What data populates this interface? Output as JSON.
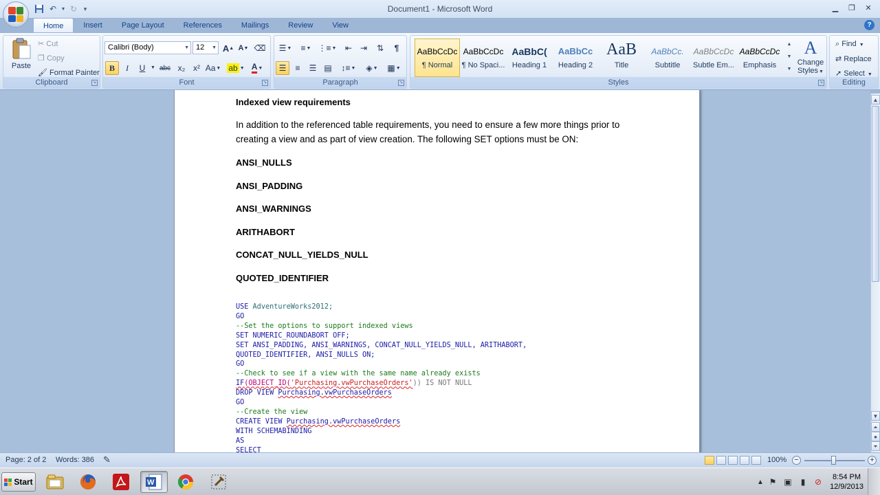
{
  "window": {
    "title": "Document1 - Microsoft Word",
    "help_label": "?"
  },
  "quick_access": {
    "save_icon": "save-icon",
    "undo_icon": "undo-icon",
    "redo_icon": "redo-icon",
    "customize_icon": "customize-qat-icon"
  },
  "tabs": [
    "Home",
    "Insert",
    "Page Layout",
    "References",
    "Mailings",
    "Review",
    "View"
  ],
  "active_tab": "Home",
  "ribbon": {
    "clipboard": {
      "label": "Clipboard",
      "paste": "Paste",
      "cut": "Cut",
      "copy": "Copy",
      "format_painter": "Format Painter"
    },
    "font": {
      "label": "Font",
      "font_name": "Calibri (Body)",
      "font_size": "12",
      "bold": "B",
      "italic": "I",
      "underline": "U",
      "strikethrough": "abc",
      "subscript": "x₂",
      "superscript": "x²",
      "change_case": "Aa",
      "font_color": "A",
      "grow": "A",
      "shrink": "A"
    },
    "paragraph": {
      "label": "Paragraph",
      "pilcrow": "¶"
    },
    "styles": {
      "label": "Styles",
      "items": [
        {
          "sample": "AaBbCcDc",
          "name": "¶ Normal"
        },
        {
          "sample": "AaBbCcDc",
          "name": "¶ No Spaci..."
        },
        {
          "sample": "AaBbC(",
          "name": "Heading 1"
        },
        {
          "sample": "AaBbCc",
          "name": "Heading 2"
        },
        {
          "sample": "AaB",
          "name": "Title"
        },
        {
          "sample": "AaBbCc.",
          "name": "Subtitle"
        },
        {
          "sample": "AaBbCcDc",
          "name": "Subtle Em..."
        },
        {
          "sample": "AaBbCcDc",
          "name": "Emphasis"
        }
      ],
      "change_styles_line1": "Change",
      "change_styles_line2": "Styles"
    },
    "editing": {
      "label": "Editing",
      "find": "Find",
      "replace": "Replace",
      "select": "Select"
    }
  },
  "document": {
    "heading": "Indexed view requirements",
    "paragraph_line1": "In addition to the referenced table requirements, you need to ensure a few more things prior to",
    "paragraph_line2": "creating a view and as part of view creation. The following SET options must be ON:",
    "options": [
      "ANSI_NULLS",
      "ANSI_PADDING",
      "ANSI_WARNINGS",
      "ARITHABORT",
      "CONCAT_NULL_YIELDS_NULL",
      "QUOTED_IDENTIFIER"
    ],
    "code": {
      "l1_kw": "USE ",
      "l1_db": "AdventureWorks2012;",
      "l2": "GO",
      "l3": "--Set the options to support indexed views",
      "l4": "SET NUMERIC_ROUNDABORT OFF;",
      "l5": "SET ANSI_PADDING, ANSI_WARNINGS, CONCAT_NULL_YIELDS_NULL, ARITHABORT,",
      "l6": "QUOTED_IDENTIFIER, ANSI_NULLS ON;",
      "l7": "GO",
      "l8": "--Check to see if a view with the same name already exists",
      "l9_if": "IF",
      "l9_fn": "(OBJECT_ID(",
      "l9_str": "'Purchasing.vwPurchaseOrders'",
      "l9_rest": ")) IS NOT NULL",
      "l10_kw": "DROP VIEW ",
      "l10_obj": "Purchasing.vwPurchaseOrders",
      "l11": "GO",
      "l12": "--Create the view",
      "l13_kw": "CREATE VIEW ",
      "l13_obj": "Purchasing.vwPurchaseOrders",
      "l14": "WITH SCHEMABINDING",
      "l15": "AS",
      "l16": "SELECT"
    }
  },
  "status": {
    "page": "Page: 2 of 2",
    "words": "Words: 386",
    "zoom": "100%",
    "zoom_minus": "−",
    "zoom_plus": "+"
  },
  "taskbar": {
    "start": "Start",
    "apps": [
      "file-explorer-icon",
      "firefox-icon",
      "adobe-reader-icon",
      "word-icon",
      "chrome-icon",
      "tools-icon"
    ],
    "clock_time": "8:54 PM",
    "clock_date": "12/9/2013"
  },
  "colors": {
    "ribbon_bg": "#e2ebf7",
    "doc_bg": "#a8bfdb",
    "keyword": "#1a1aa6",
    "comment": "#1b7a1b"
  }
}
